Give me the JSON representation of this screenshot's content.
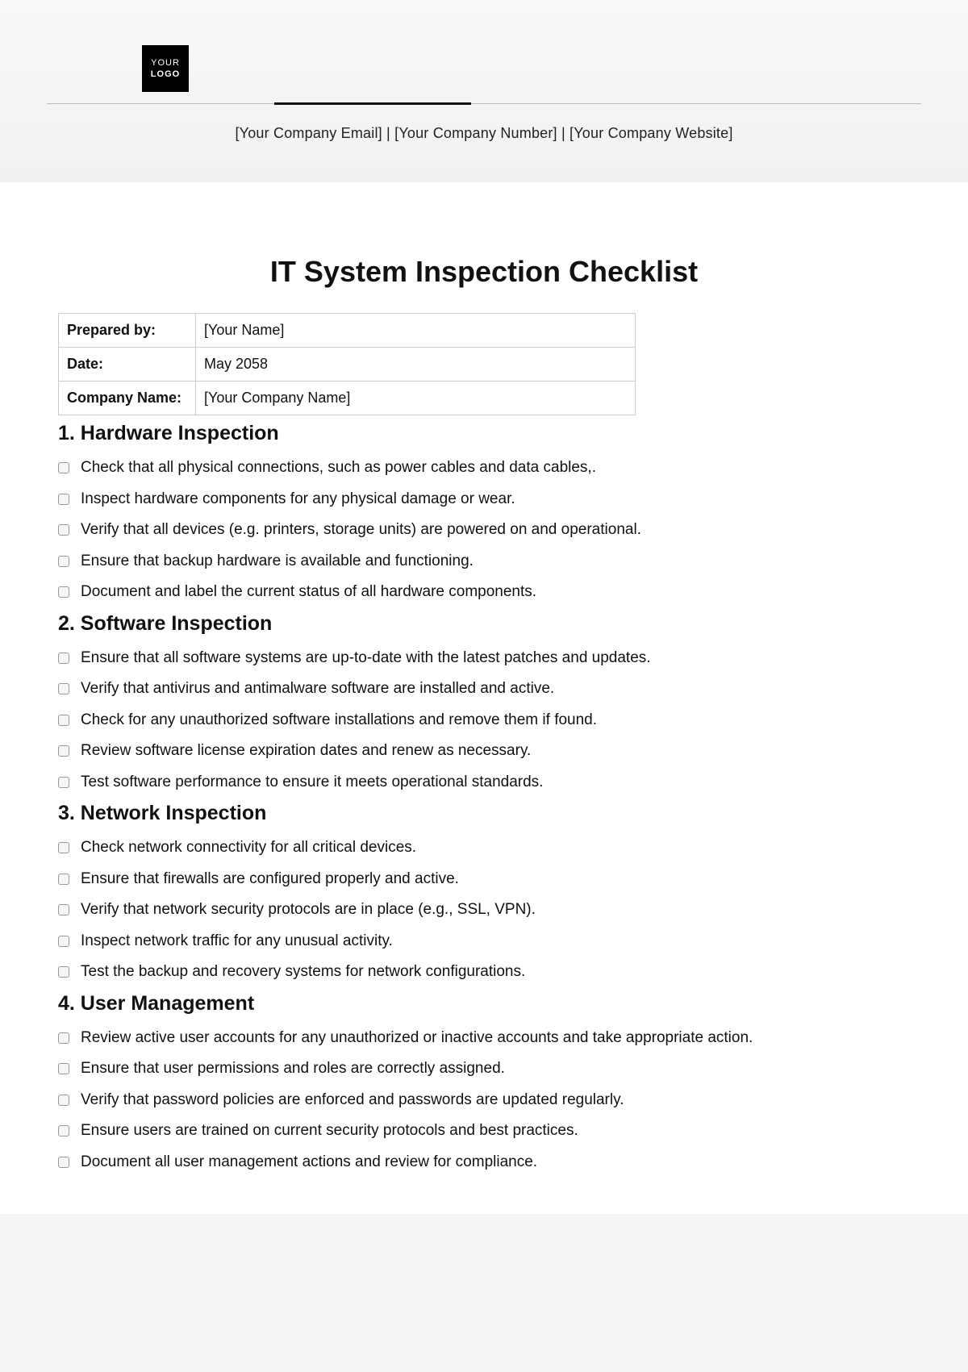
{
  "logo": {
    "line1": "YOUR",
    "line2": "LOGO"
  },
  "contact": "[Your Company Email] | [Your Company Number] | [Your Company Website]",
  "title": "IT System Inspection Checklist",
  "meta": [
    {
      "label": "Prepared by:",
      "value": "[Your Name]"
    },
    {
      "label": "Date:",
      "value": "May 2058"
    },
    {
      "label": "Company Name:",
      "value": "[Your Company Name]"
    }
  ],
  "sections": [
    {
      "heading": "1. Hardware Inspection",
      "items": [
        "Check that all physical connections, such as power cables and data cables,.",
        "Inspect hardware components for any physical damage or wear.",
        "Verify that all devices (e.g. printers, storage units) are powered on and operational.",
        "Ensure that backup hardware is available and functioning.",
        "Document and label the current status of all hardware components."
      ]
    },
    {
      "heading": "2. Software Inspection",
      "items": [
        "Ensure that all software systems are up-to-date with the latest patches and updates.",
        "Verify that antivirus and antimalware software are installed and active.",
        "Check for any unauthorized software installations and remove them if found.",
        "Review software license expiration dates and renew as necessary.",
        "Test software performance to ensure it meets operational standards."
      ]
    },
    {
      "heading": "3. Network Inspection",
      "items": [
        "Check network connectivity for all critical devices.",
        "Ensure that firewalls are configured properly and active.",
        "Verify that network security protocols are in place (e.g., SSL, VPN).",
        "Inspect network traffic for any unusual activity.",
        "Test the backup and recovery systems for network configurations."
      ]
    },
    {
      "heading": "4. User Management",
      "items": [
        "Review active user accounts for any unauthorized or inactive accounts and take appropriate action.",
        "Ensure that user permissions and roles are correctly assigned.",
        "Verify that password policies are enforced and passwords are updated regularly.",
        "Ensure users are trained on current security protocols and best practices.",
        "Document all user management actions and review for compliance."
      ]
    }
  ]
}
